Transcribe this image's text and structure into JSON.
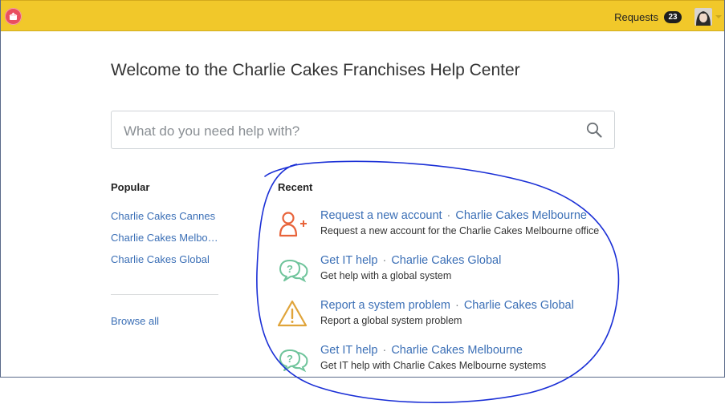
{
  "header": {
    "requests_label": "Requests",
    "requests_count": "23",
    "bar_color": "#f1c82a"
  },
  "main": {
    "welcome_title": "Welcome to the Charlie Cakes Franchises Help Center",
    "search": {
      "placeholder": "What do you need help with?"
    }
  },
  "popular": {
    "heading": "Popular",
    "links": [
      "Charlie Cakes Cannes",
      "Charlie Cakes Melbo…",
      "Charlie Cakes Global"
    ],
    "browse_all": "Browse all"
  },
  "recent": {
    "heading": "Recent",
    "items": [
      {
        "icon": "add-user-icon",
        "title": "Request a new account",
        "project": "Charlie Cakes Melbourne",
        "description": "Request a new account for the Charlie Cakes Melbourne office"
      },
      {
        "icon": "help-bubble-icon",
        "title": "Get IT help",
        "project": "Charlie Cakes Global",
        "description": "Get help with a global system"
      },
      {
        "icon": "warning-icon",
        "title": "Report a system problem",
        "project": "Charlie Cakes Global",
        "description": "Report a global system problem"
      },
      {
        "icon": "help-bubble-icon",
        "title": "Get IT help",
        "project": "Charlie Cakes Melbourne",
        "description": "Get IT help with Charlie Cakes Melbourne systems"
      }
    ]
  },
  "colors": {
    "link": "#3b6fb6",
    "annotation": "#1a2fd6"
  }
}
